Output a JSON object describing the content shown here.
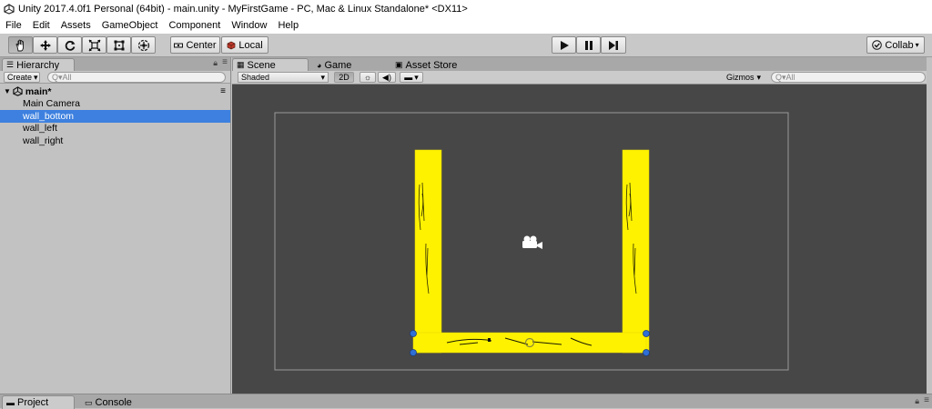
{
  "window": {
    "title": "Unity 2017.4.0f1 Personal (64bit) - main.unity - MyFirstGame - PC, Mac & Linux Standalone* <DX11>"
  },
  "menu": [
    "File",
    "Edit",
    "Assets",
    "GameObject",
    "Component",
    "Window",
    "Help"
  ],
  "toolbar": {
    "pivot_label": "Center",
    "space_label": "Local",
    "collab_label": "Collab"
  },
  "hierarchy": {
    "tab_label": "Hierarchy",
    "create_label": "Create",
    "search_placeholder": "Q▾All",
    "scene_name": "main*",
    "items": [
      "Main Camera",
      "wall_bottom",
      "wall_left",
      "wall_right"
    ],
    "selected_index": 1
  },
  "scene_view": {
    "tabs": [
      "Scene",
      "Game",
      "Asset Store"
    ],
    "shading_label": "Shaded",
    "mode_2d_label": "2D",
    "gizmos_label": "Gizmos",
    "search_placeholder": "Q▾All"
  },
  "bottom": {
    "tabs": [
      "Project",
      "Console"
    ]
  },
  "colors": {
    "selection": "#3d80df",
    "scene_bg": "#474747",
    "wall": "#fff200",
    "handle": "#2f6fd6"
  }
}
